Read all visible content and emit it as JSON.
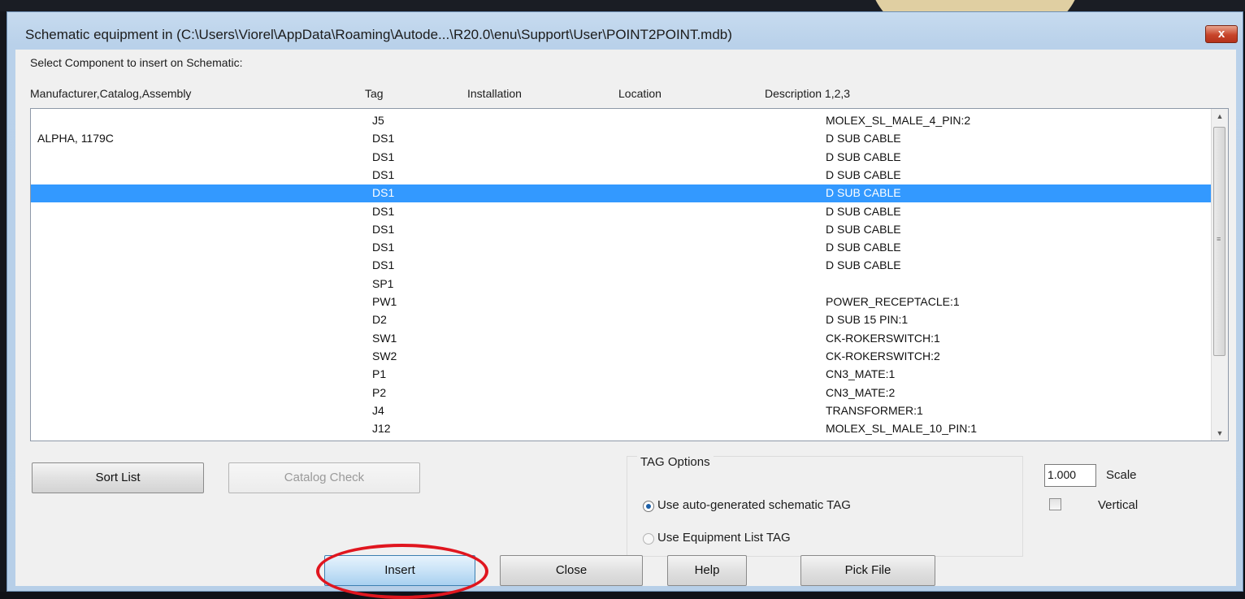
{
  "dialog": {
    "title": "Schematic equipment in (C:\\Users\\Viorel\\AppData\\Roaming\\Autode...\\R20.0\\enu\\Support\\User\\POINT2POINT.mdb)",
    "close_glyph": "x",
    "select_label": "Select Component to insert on Schematic:"
  },
  "columns": {
    "manufacturer": "Manufacturer,Catalog,Assembly",
    "tag": "Tag",
    "installation": "Installation",
    "location": "Location",
    "description": "Description 1,2,3"
  },
  "rows": [
    {
      "mfr": "",
      "tag": "J5",
      "desc": "MOLEX_SL_MALE_4_PIN:2",
      "selected": false
    },
    {
      "mfr": "ALPHA, 1179C",
      "tag": "DS1",
      "desc": "D SUB CABLE",
      "selected": false
    },
    {
      "mfr": "",
      "tag": "DS1",
      "desc": "D SUB CABLE",
      "selected": false
    },
    {
      "mfr": "",
      "tag": "DS1",
      "desc": "D SUB CABLE",
      "selected": false
    },
    {
      "mfr": "",
      "tag": "DS1",
      "desc": "D SUB CABLE",
      "selected": true
    },
    {
      "mfr": "",
      "tag": "DS1",
      "desc": "D SUB CABLE",
      "selected": false
    },
    {
      "mfr": "",
      "tag": "DS1",
      "desc": "D SUB CABLE",
      "selected": false
    },
    {
      "mfr": "",
      "tag": "DS1",
      "desc": "D SUB CABLE",
      "selected": false
    },
    {
      "mfr": "",
      "tag": "DS1",
      "desc": "D SUB CABLE",
      "selected": false
    },
    {
      "mfr": "",
      "tag": "SP1",
      "desc": "",
      "selected": false
    },
    {
      "mfr": "",
      "tag": "PW1",
      "desc": "POWER_RECEPTACLE:1",
      "selected": false
    },
    {
      "mfr": "",
      "tag": "D2",
      "desc": "D SUB 15 PIN:1",
      "selected": false
    },
    {
      "mfr": "",
      "tag": "SW1",
      "desc": "CK-ROKERSWITCH:1",
      "selected": false
    },
    {
      "mfr": "",
      "tag": "SW2",
      "desc": "CK-ROKERSWITCH:2",
      "selected": false
    },
    {
      "mfr": "",
      "tag": "P1",
      "desc": "CN3_MATE:1",
      "selected": false
    },
    {
      "mfr": "",
      "tag": "P2",
      "desc": "CN3_MATE:2",
      "selected": false
    },
    {
      "mfr": "",
      "tag": "J4",
      "desc": "TRANSFORMER:1",
      "selected": false
    },
    {
      "mfr": "",
      "tag": "J12",
      "desc": "MOLEX_SL_MALE_10_PIN:1",
      "selected": false
    }
  ],
  "buttons": {
    "sort_list": "Sort List",
    "catalog_check": "Catalog Check",
    "insert": "Insert",
    "close": "Close",
    "help": "Help",
    "pick_file": "Pick File"
  },
  "tag_options": {
    "title": "TAG Options",
    "auto_label": "Use auto-generated schematic TAG",
    "auto_selected": true,
    "equip_label": "Use Equipment List TAG"
  },
  "scale": {
    "value": "1.000",
    "label": "Scale"
  },
  "vertical": {
    "label": "Vertical",
    "checked": false
  },
  "colors": {
    "selection": "#3399ff",
    "highlight_ring": "#e0161f"
  }
}
